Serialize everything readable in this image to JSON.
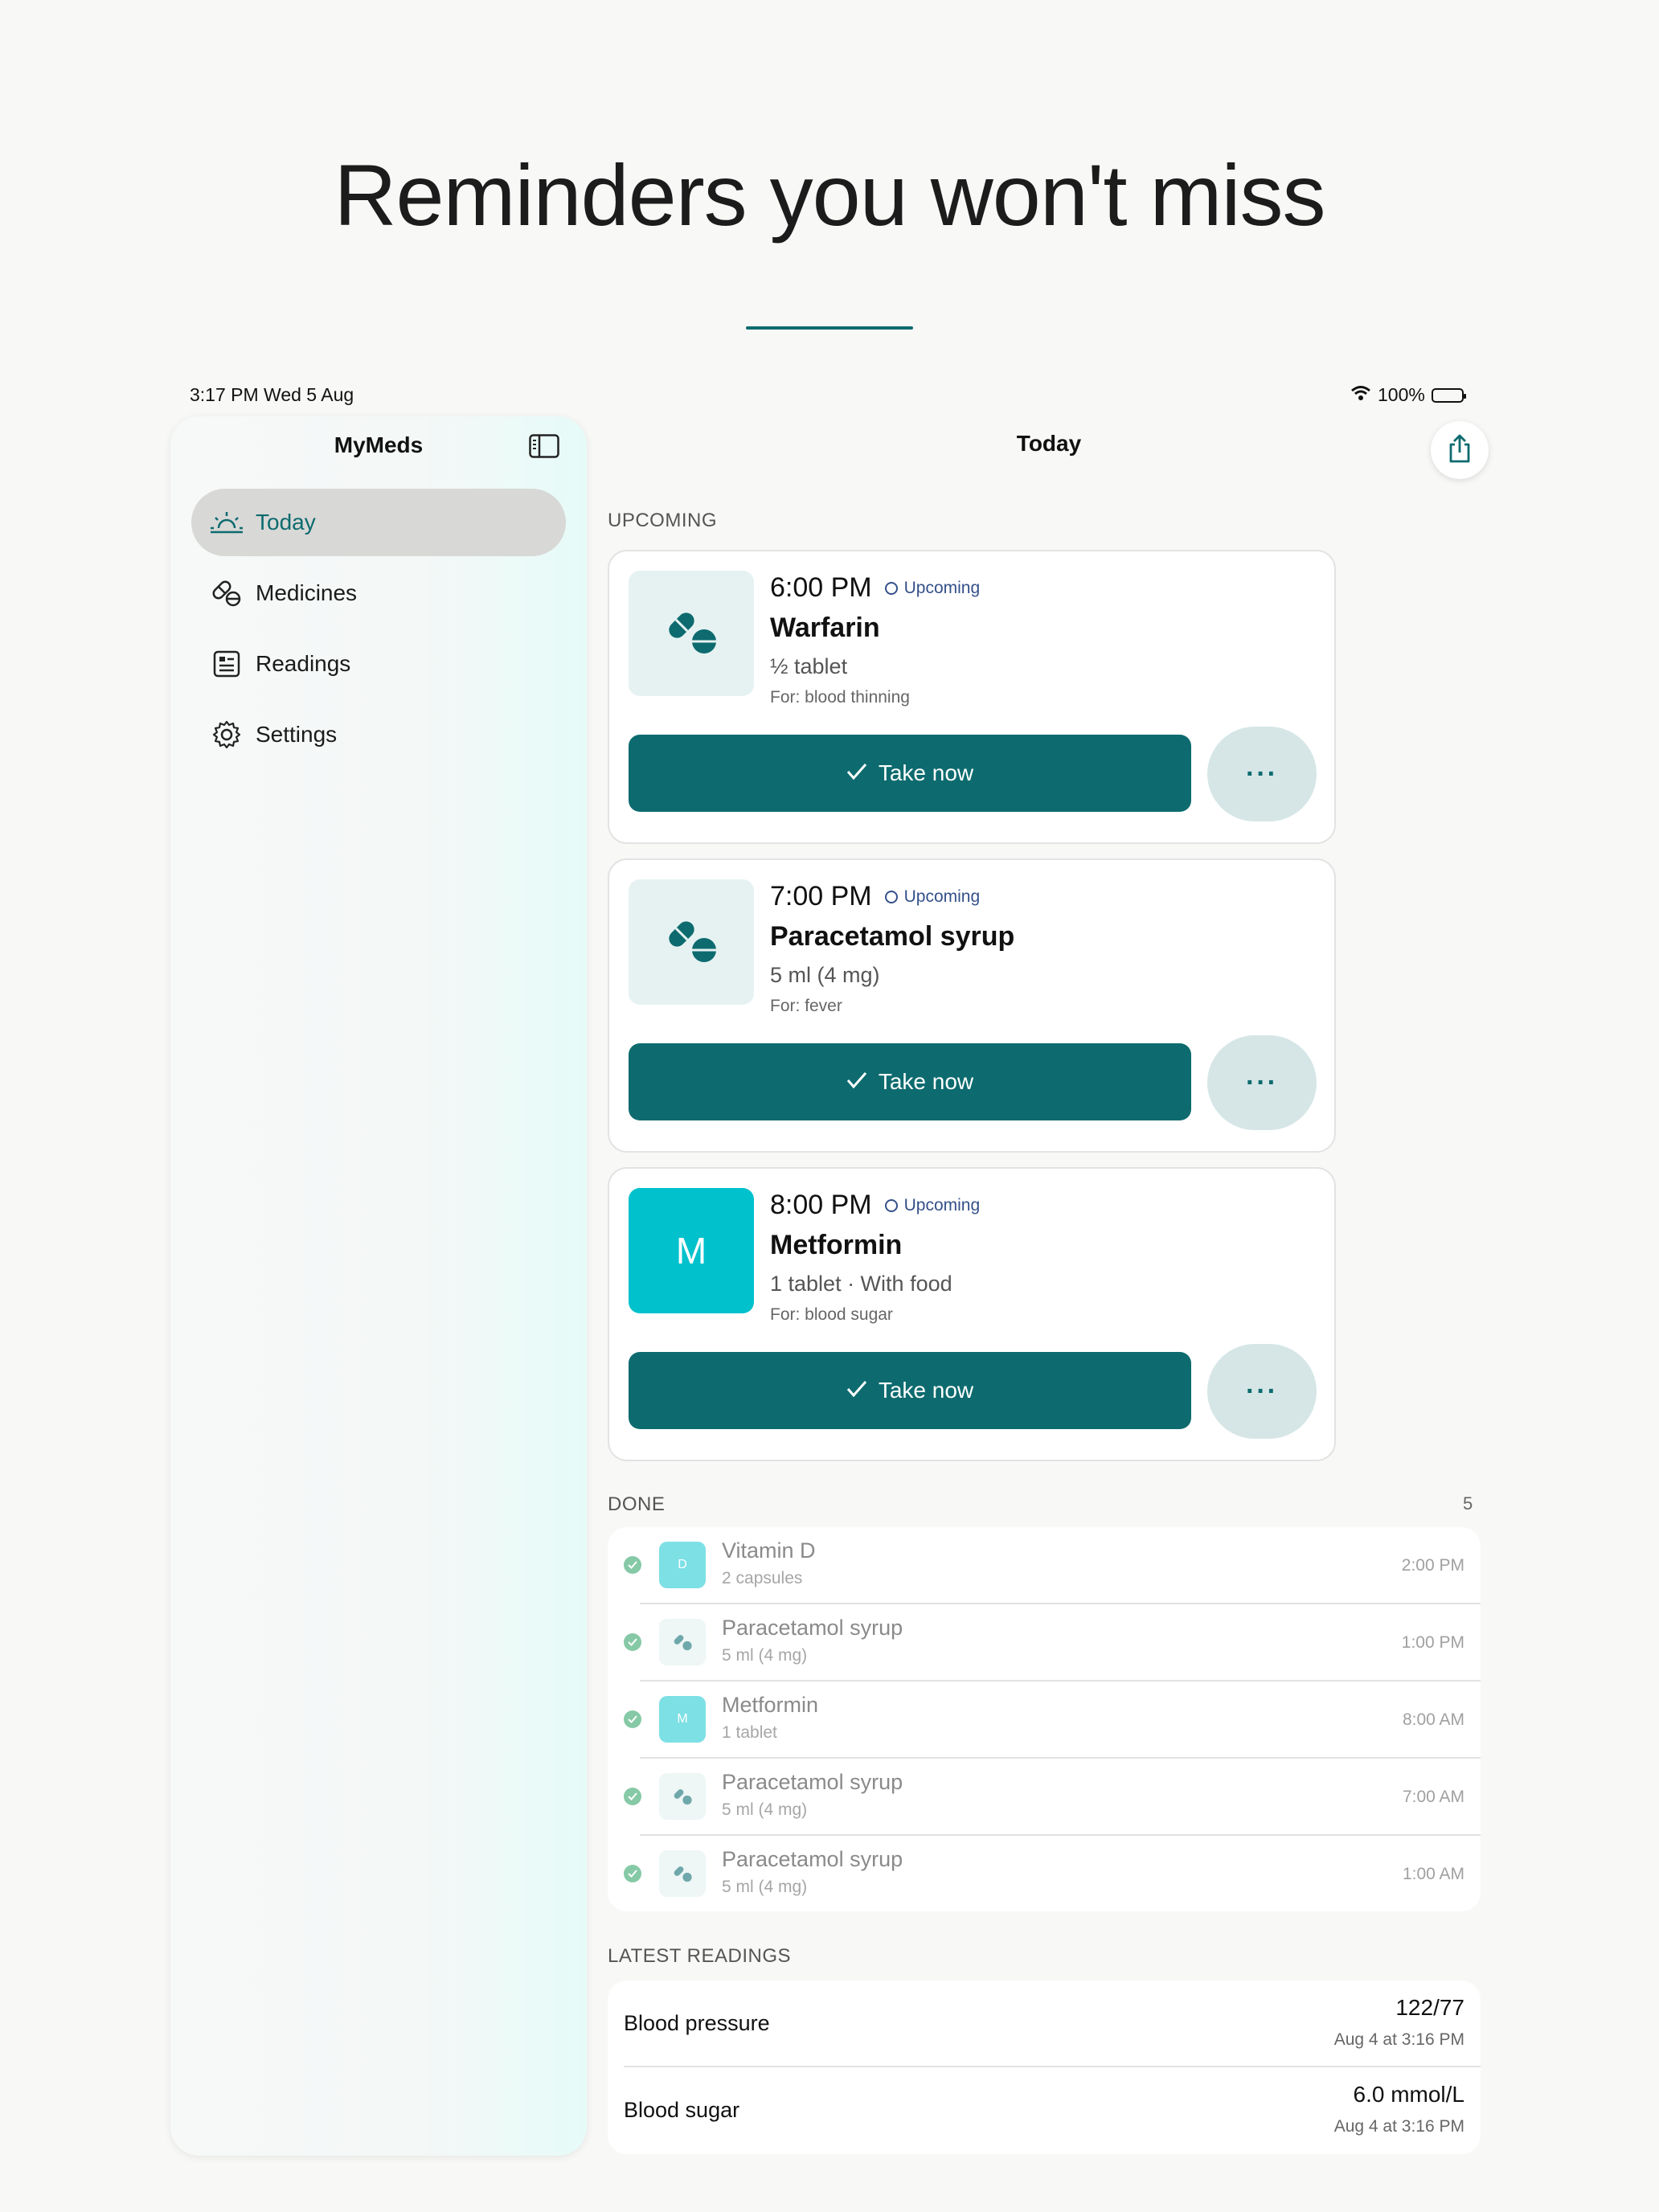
{
  "headline": "Reminders you won't miss",
  "status_bar": {
    "time": "3:17 PM   Wed 5 Aug",
    "battery": "100%"
  },
  "sidebar": {
    "title": "MyMeds",
    "items": [
      {
        "label": "Today",
        "icon": "sunrise-icon",
        "active": true
      },
      {
        "label": "Medicines",
        "icon": "pill-icon"
      },
      {
        "label": "Readings",
        "icon": "readings-icon"
      },
      {
        "label": "Settings",
        "icon": "gear-icon"
      }
    ]
  },
  "main": {
    "title": "Today",
    "upcoming_label": "UPCOMING",
    "upcoming": [
      {
        "time": "6:00 PM",
        "status": "Upcoming",
        "name": "Warfarin",
        "dose": "½ tablet",
        "for": "For: blood thinning",
        "thumb": "pills-icon",
        "action": "Take now"
      },
      {
        "time": "7:00 PM",
        "status": "Upcoming",
        "name": "Paracetamol syrup",
        "dose": "5 ml (4 mg)",
        "for": "For: fever",
        "thumb": "pills-icon",
        "action": "Take now"
      },
      {
        "time": "8:00 PM",
        "status": "Upcoming",
        "name": "Metformin",
        "dose": "1 tablet · With food",
        "for": "For: blood sugar",
        "thumb_letter": "M",
        "action": "Take now"
      }
    ],
    "more_label": "···",
    "done_label": "DONE",
    "done_count": "5",
    "done": [
      {
        "name": "Vitamin D",
        "dose": "2 capsules",
        "time": "2:00 PM",
        "thumb_letter": "D"
      },
      {
        "name": "Paracetamol syrup",
        "dose": "5 ml (4 mg)",
        "time": "1:00 PM"
      },
      {
        "name": "Metformin",
        "dose": "1 tablet",
        "time": "8:00 AM",
        "thumb_letter": "M"
      },
      {
        "name": "Paracetamol syrup",
        "dose": "5 ml (4 mg)",
        "time": "7:00 AM"
      },
      {
        "name": "Paracetamol syrup",
        "dose": "5 ml (4 mg)",
        "time": "1:00 AM"
      }
    ],
    "readings_label": "LATEST READINGS",
    "readings": [
      {
        "name": "Blood pressure",
        "value": "122/77",
        "when": "Aug 4 at 3:16 PM"
      },
      {
        "name": "Blood sugar",
        "value": "6.0 mmol/L",
        "when": "Aug 4 at 3:16 PM"
      }
    ]
  },
  "colors": {
    "accent": "#0d6b6f",
    "letter_thumb": "#00c1cc",
    "upcoming": "#34508a",
    "done_check": "#86c9a6"
  }
}
